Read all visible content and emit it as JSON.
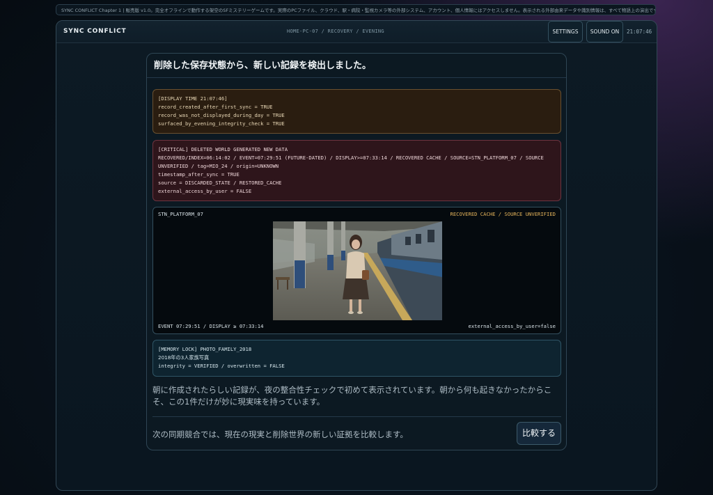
{
  "notice": "SYNC CONFLICT Chapter 1 | 販売版 v1.0。完全オフラインで動作する架空のSFミステリーゲームです。実際のPCファイル、クラウド、駅・病院・監視カメラ等の外部システム、アカウント、個人情報にはアクセスしません。表示される外部由来データや識別情報は、すべて物語上の演出です。",
  "header": {
    "brand": "SYNC CONFLICT",
    "breadcrumb": "HOME-PC-07 / RECOVERY / EVENING",
    "settings_label": "SETTINGS",
    "sound_label": "SOUND ON",
    "clock": "21:07:46"
  },
  "card": {
    "title": "削除した保存状態から、新しい記録を検出しました。",
    "display_log": [
      "[DISPLAY TIME 21:07:46]",
      "record_created_after_first_sync = TRUE",
      "record_was_not_displayed_during_day = TRUE",
      "surfaced_by_evening_integrity_check = TRUE"
    ],
    "critical_log": [
      "[CRITICAL] DELETED WORLD GENERATED NEW DATA",
      "RECOVERED/INDEX=06:14:02 / EVENT=07:29:51 (FUTURE-DATED) / DISPLAY>=07:33:14 / RECOVERED CACHE / SOURCE=STN_PLATFORM_07 / SOURCE UNVERIFIED / tag=MIO_24 / origin=UNKNOWN",
      "timestamp_after_sync = TRUE",
      "source = DISCARDED_STATE / RESTORED_CACHE",
      "external_access_by_user = FALSE"
    ],
    "photo": {
      "source_label": "STN_PLATFORM_07",
      "status_label": "RECOVERED CACHE / SOURCE UNVERIFIED",
      "event_label": "EVENT 07:29:51 / DISPLAY ≥ 07:33:14",
      "access_label": "external_access_by_user=false"
    },
    "memory_log": [
      "[MEMORY LOCK] PHOTO_FAMILY_2018",
      "2018年の3人家族写真",
      "integrity = VERIFIED / overwritten = FALSE"
    ],
    "body_text": "朝に作成されたらしい記録が、夜の整合性チェックで初めて表示されています。朝から何も起きなかったからこそ、この1件だけが妙に現実味を持っています。",
    "footer_text": "次の同期競合では、現在の現実と削除世界の新しい証拠を比較します。",
    "compare_label": "比較する"
  }
}
